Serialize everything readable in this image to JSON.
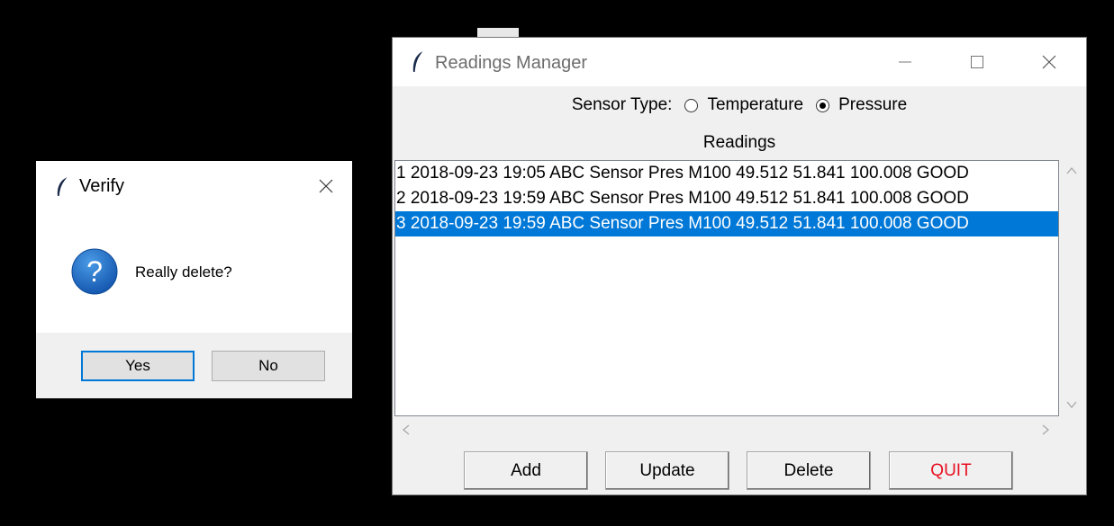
{
  "verify_dialog": {
    "title": "Verify",
    "message": "Really delete?",
    "yes_label": "Yes",
    "no_label": "No",
    "icon": "question-icon"
  },
  "main_window": {
    "title": "Readings Manager",
    "sensor_type_label": "Sensor Type:",
    "radio_options": [
      {
        "label": "Temperature",
        "selected": false
      },
      {
        "label": "Pressure",
        "selected": true
      }
    ],
    "readings_label": "Readings",
    "readings": [
      {
        "text": "1 2018-09-23 19:05 ABC Sensor Pres M100 49.512 51.841 100.008 GOOD",
        "selected": false
      },
      {
        "text": "2 2018-09-23 19:59 ABC Sensor Pres M100 49.512 51.841 100.008 GOOD",
        "selected": false
      },
      {
        "text": "3 2018-09-23 19:59 ABC Sensor Pres M100 49.512 51.841 100.008 GOOD",
        "selected": true
      }
    ],
    "buttons": {
      "add": "Add",
      "update": "Update",
      "delete": "Delete",
      "quit": "QUIT"
    }
  },
  "colors": {
    "selection": "#0078d7",
    "quit_text": "#e81123",
    "question_icon": "#1f6fc5"
  }
}
